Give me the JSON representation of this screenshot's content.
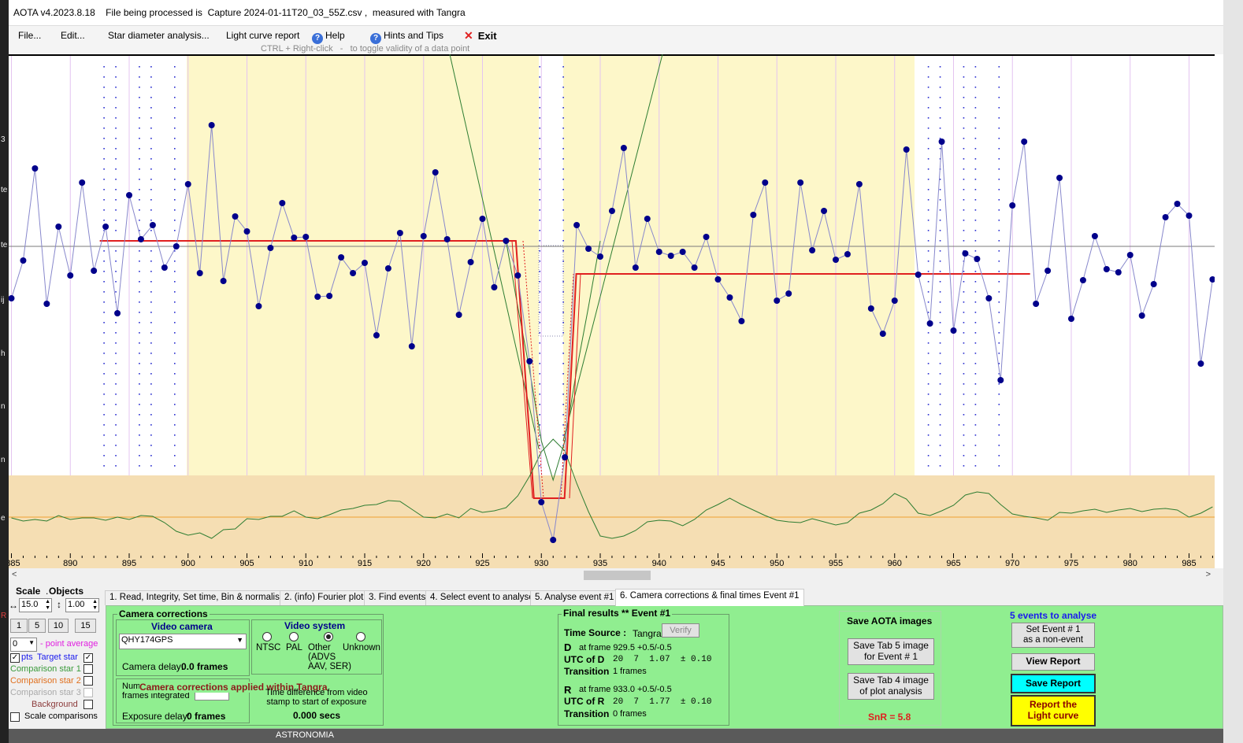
{
  "title_bar": {
    "text": "AOTA v4.2023.8.18    File being processed is  Capture 2024-01-11T20_03_55Z.csv ,  measured with Tangra"
  },
  "menu": [
    {
      "label": "File...",
      "icon": ""
    },
    {
      "label": "Edit...",
      "icon": ""
    },
    {
      "label": "Star diameter analysis...",
      "icon": ""
    },
    {
      "label": "Light curve report",
      "icon": ""
    },
    {
      "label": "Help",
      "icon": "help-icon"
    },
    {
      "label": "Hints and Tips",
      "icon": "help-icon"
    },
    {
      "label": "Exit",
      "icon": "close-icon"
    }
  ],
  "hint": "CTRL + Right-click   -   to toggle validity of a data point",
  "left_edge_labels": [
    "3",
    "te",
    "te",
    "ij",
    "h",
    "n",
    "n",
    "e",
    "R"
  ],
  "chart_data": {
    "type": "line",
    "x_range": [
      885,
      988
    ],
    "x_ticks": [
      885,
      890,
      895,
      900,
      905,
      910,
      915,
      920,
      925,
      930,
      935,
      940,
      945,
      950,
      955,
      960,
      965,
      970,
      975,
      980,
      985
    ],
    "grid": true,
    "series": [
      {
        "role": "target-star",
        "color": "#2a2f8c",
        "points": [
          [
            885,
            379
          ],
          [
            886,
            331
          ],
          [
            887,
            214
          ],
          [
            888,
            386
          ],
          [
            889,
            288
          ],
          [
            890,
            350
          ],
          [
            891,
            232
          ],
          [
            892,
            344
          ],
          [
            893,
            288
          ],
          [
            894,
            398
          ],
          [
            895,
            248
          ],
          [
            896,
            304
          ],
          [
            897,
            286
          ],
          [
            898,
            340
          ],
          [
            899,
            313
          ],
          [
            900,
            234
          ],
          [
            901,
            347
          ],
          [
            902,
            159
          ],
          [
            903,
            357
          ],
          [
            904,
            275
          ],
          [
            905,
            294
          ],
          [
            906,
            389
          ],
          [
            907,
            315
          ],
          [
            908,
            258
          ],
          [
            909,
            302
          ],
          [
            910,
            301
          ],
          [
            911,
            377
          ],
          [
            912,
            376
          ],
          [
            913,
            327
          ],
          [
            914,
            347
          ],
          [
            915,
            334
          ],
          [
            916,
            426
          ],
          [
            917,
            341
          ],
          [
            918,
            296
          ],
          [
            919,
            440
          ],
          [
            920,
            300
          ],
          [
            921,
            219
          ],
          [
            922,
            304
          ],
          [
            923,
            400
          ],
          [
            924,
            333
          ],
          [
            925,
            278
          ],
          [
            926,
            365
          ],
          [
            927,
            306
          ],
          [
            928,
            350
          ],
          [
            929,
            459
          ],
          [
            930,
            638
          ],
          [
            931,
            686
          ],
          [
            932,
            581
          ],
          [
            933,
            286
          ],
          [
            934,
            316
          ],
          [
            935,
            326
          ],
          [
            936,
            268
          ],
          [
            937,
            188
          ],
          [
            938,
            340
          ],
          [
            939,
            278
          ],
          [
            940,
            320
          ],
          [
            941,
            325
          ],
          [
            942,
            320
          ],
          [
            943,
            340
          ],
          [
            944,
            301
          ],
          [
            945,
            355
          ],
          [
            946,
            378
          ],
          [
            947,
            408
          ],
          [
            948,
            273
          ],
          [
            949,
            232
          ],
          [
            950,
            382
          ],
          [
            951,
            373
          ],
          [
            952,
            232
          ],
          [
            953,
            318
          ],
          [
            954,
            268
          ],
          [
            955,
            330
          ],
          [
            956,
            323
          ],
          [
            957,
            234
          ],
          [
            958,
            392
          ],
          [
            959,
            424
          ],
          [
            960,
            382
          ],
          [
            961,
            190
          ],
          [
            962,
            349
          ],
          [
            963,
            411
          ],
          [
            964,
            180
          ],
          [
            965,
            420
          ],
          [
            966,
            322
          ],
          [
            967,
            329
          ],
          [
            968,
            379
          ],
          [
            969,
            483
          ],
          [
            970,
            261
          ],
          [
            971,
            180
          ],
          [
            972,
            386
          ],
          [
            973,
            344
          ],
          [
            974,
            226
          ],
          [
            975,
            405
          ],
          [
            976,
            356
          ],
          [
            977,
            300
          ],
          [
            978,
            342
          ],
          [
            979,
            346
          ],
          [
            980,
            324
          ],
          [
            981,
            401
          ],
          [
            982,
            361
          ],
          [
            983,
            276
          ],
          [
            984,
            259
          ],
          [
            985,
            274
          ],
          [
            986,
            462
          ],
          [
            987,
            355
          ]
        ]
      },
      {
        "role": "background",
        "color": "#2e7d32",
        "points": [
          [
            885,
            658
          ],
          [
            886,
            662
          ],
          [
            887,
            660
          ],
          [
            888,
            662
          ],
          [
            889,
            655
          ],
          [
            890,
            660
          ],
          [
            891,
            658
          ],
          [
            892,
            658
          ],
          [
            893,
            661
          ],
          [
            894,
            657
          ],
          [
            895,
            660
          ],
          [
            896,
            655
          ],
          [
            897,
            656
          ],
          [
            898,
            664
          ],
          [
            899,
            675
          ],
          [
            900,
            680
          ],
          [
            901,
            677
          ],
          [
            902,
            684
          ],
          [
            903,
            673
          ],
          [
            904,
            672
          ],
          [
            905,
            659
          ],
          [
            906,
            660
          ],
          [
            907,
            656
          ],
          [
            908,
            656
          ],
          [
            909,
            649
          ],
          [
            910,
            657
          ],
          [
            911,
            659
          ],
          [
            912,
            654
          ],
          [
            913,
            648
          ],
          [
            914,
            646
          ],
          [
            915,
            642
          ],
          [
            916,
            641
          ],
          [
            917,
            636
          ],
          [
            918,
            637
          ],
          [
            919,
            647
          ],
          [
            920,
            657
          ],
          [
            921,
            658
          ],
          [
            922,
            653
          ],
          [
            923,
            658
          ],
          [
            924,
            646
          ],
          [
            925,
            651
          ],
          [
            926,
            649
          ],
          [
            927,
            645
          ],
          [
            928,
            630
          ],
          [
            929,
            605
          ],
          [
            930,
            574
          ],
          [
            931,
            558
          ],
          [
            932,
            573
          ],
          [
            933,
            614
          ],
          [
            934,
            650
          ],
          [
            935,
            681
          ],
          [
            936,
            684
          ],
          [
            937,
            681
          ],
          [
            938,
            674
          ],
          [
            939,
            663
          ],
          [
            940,
            661
          ],
          [
            941,
            662
          ],
          [
            942,
            668
          ],
          [
            943,
            660
          ],
          [
            944,
            648
          ],
          [
            945,
            641
          ],
          [
            946,
            633
          ],
          [
            947,
            641
          ],
          [
            948,
            648
          ],
          [
            949,
            655
          ],
          [
            950,
            661
          ],
          [
            951,
            663
          ],
          [
            952,
            664
          ],
          [
            953,
            659
          ],
          [
            954,
            663
          ],
          [
            955,
            667
          ],
          [
            956,
            664
          ],
          [
            957,
            652
          ],
          [
            958,
            648
          ],
          [
            959,
            640
          ],
          [
            960,
            627
          ],
          [
            961,
            634
          ],
          [
            962,
            652
          ],
          [
            963,
            655
          ],
          [
            964,
            649
          ],
          [
            965,
            642
          ],
          [
            966,
            629
          ],
          [
            967,
            625
          ],
          [
            968,
            627
          ],
          [
            969,
            641
          ],
          [
            970,
            653
          ],
          [
            971,
            656
          ],
          [
            972,
            658
          ],
          [
            973,
            661
          ],
          [
            974,
            651
          ],
          [
            975,
            652
          ],
          [
            976,
            649
          ],
          [
            977,
            647
          ],
          [
            978,
            651
          ],
          [
            979,
            648
          ],
          [
            980,
            646
          ],
          [
            981,
            650
          ],
          [
            982,
            647
          ],
          [
            983,
            646
          ],
          [
            984,
            648
          ],
          [
            985,
            657
          ],
          [
            986,
            652
          ],
          [
            987,
            644
          ]
        ]
      }
    ],
    "model_fit": {
      "color": "#e02020",
      "baseline": {
        "x": [
          892.5,
          927.5
        ],
        "level": 306
      },
      "d_edge": {
        "x": [
          927.5,
          929.5
        ],
        "bottom": 633
      },
      "r_edge": {
        "x": [
          931.5,
          933.5
        ],
        "bottom": 633
      },
      "post": {
        "x": [
          933.5,
          971.5
        ],
        "level": 348
      }
    },
    "d_frame": 929.5,
    "r_frame": 933.0
  },
  "left_panel": {
    "scale_label": "Scale",
    "objects_label": "Objects",
    "scale_x": "15.0",
    "scale_y": "1.00",
    "zoom_buttons": [
      "1",
      "5",
      "10",
      "15"
    ],
    "point_average_value": "0",
    "point_average_label": "- point average",
    "pts_label": "pts",
    "objects": [
      {
        "label": "Target star",
        "color": "#1a1aee",
        "checked": true
      },
      {
        "label": "Comparison star 1",
        "color": "#3a9a3a",
        "checked": false
      },
      {
        "label": "Comparison star 2",
        "color": "#e0701e",
        "checked": false
      },
      {
        "label": "Comparison star 3",
        "color": "#aaaaaa",
        "checked": false
      },
      {
        "label": "Background",
        "color": "#8b3a3a",
        "checked": false
      }
    ],
    "scale_comparisons_label": "Scale comparisons"
  },
  "tabs": [
    "1.  Read, Integrity, Set time, Bin & normalise",
    "2. (info)  Fourier plot",
    "3. Find events",
    "4. Select event to analyse",
    "5. Analyse event #1",
    "6. Camera corrections & final times Event #1"
  ],
  "camera_corrections": {
    "title": "Camera corrections",
    "video_camera_title": "Video camera",
    "camera_value": "QHY174GPS",
    "camera_delay_label": "Camera delay:",
    "camera_delay_value": "0.0 frames",
    "video_system_title": "Video system",
    "video_systems": [
      {
        "label": "NTSC",
        "selected": false
      },
      {
        "label": "PAL",
        "selected": false
      },
      {
        "label": "Other\n(ADVS\nAAV, SER)",
        "selected": true
      },
      {
        "label": "Unknown",
        "selected": false
      }
    ],
    "num_frames_label": "Num\nframes integrated",
    "overlay_message": "Camera corrections applied within Tangra",
    "time_diff_label": "Time difference from video\nstamp to start of exposure",
    "time_diff_value": "0.000 secs",
    "exposure_delay_label": "Exposure delay:",
    "exposure_delay_value": "0 frames"
  },
  "final_results": {
    "title": "Final results  **  Event #1",
    "time_source_label": "Time Source :",
    "time_source_value": "Tangra",
    "verify_button": "Verify",
    "d_label": "D",
    "d_frame_text": "at frame 929.5  +0.5/-0.5",
    "utc_d_label": "UTC of D",
    "utc_d_value": "20  7  1.07  ± 0.10",
    "transition_label": "Transition",
    "d_transition_value": "1 frames",
    "r_label": "R",
    "r_frame_text": "at frame 933.0  +0.5/-0.5",
    "utc_r_label": "UTC of R",
    "utc_r_value": "20  7  1.77  ± 0.10",
    "r_transition_value": "0 frames"
  },
  "save_images": {
    "title": "Save AOTA images",
    "tab5_button": "Save Tab 5 image\nfor Event # 1",
    "tab4_button": "Save Tab 4 image\nof plot analysis",
    "snr": "SnR = 5.8"
  },
  "events_panel": {
    "title": "5 events to analyse",
    "set_event_button": "Set Event # 1\nas a non-event",
    "view_report_button": "View Report",
    "save_report_button": "Save Report",
    "report_lc_button": "Report the\nLight curve"
  },
  "taskbar_text": "ASTRONOMIA",
  "colors": {
    "plot_background_yellow": "#fdf7c9",
    "plot_background_tan": "#f5deb3",
    "panel_green": "#90ee90",
    "save_report_cyan": "#00ffff",
    "report_lc_yellow": "#ffff00",
    "fit_red": "#e02020",
    "point_navy": "#00008b"
  }
}
